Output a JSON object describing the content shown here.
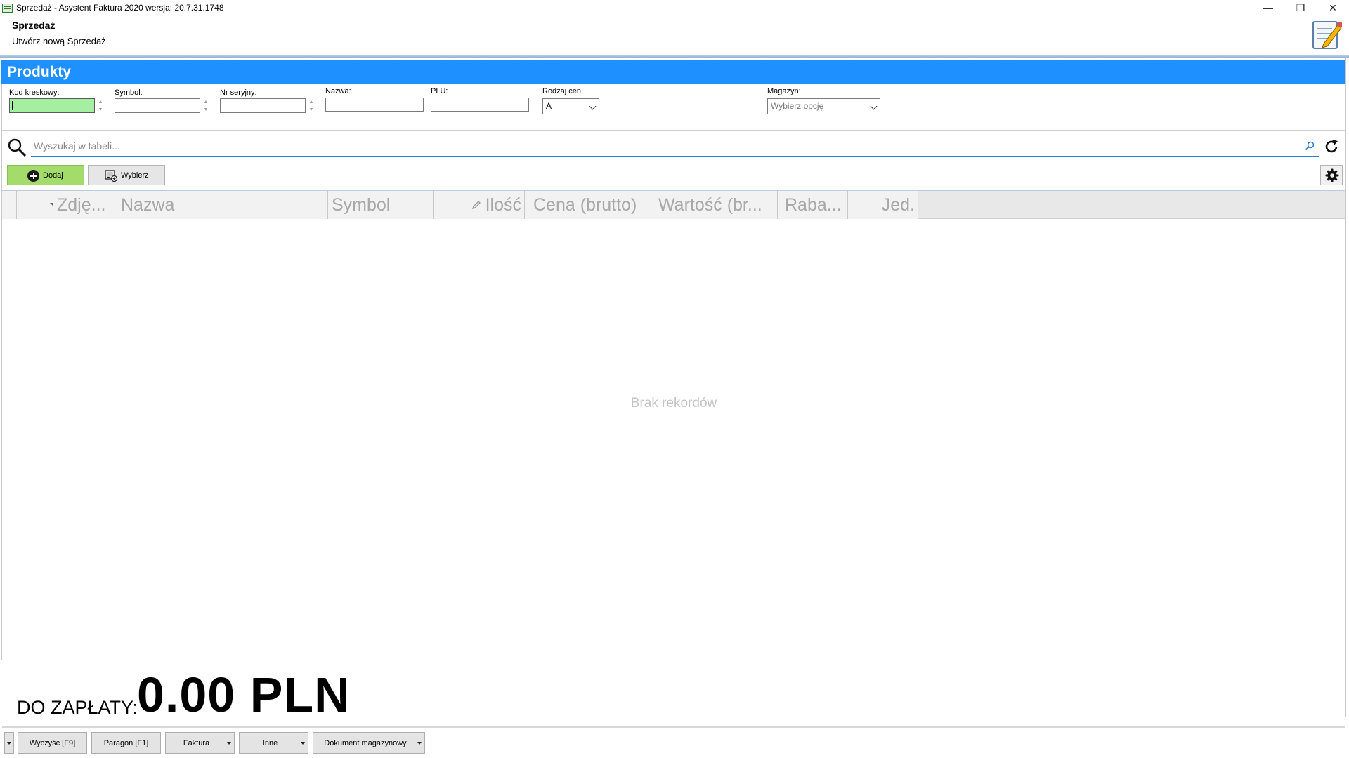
{
  "window": {
    "title": "Sprzedaż - Asystent Faktura 2020 wersja: 20.7.31.1748",
    "minimize_glyph": "—",
    "restore_glyph": "❐",
    "close_glyph": "✕"
  },
  "header": {
    "title": "Sprzedaż",
    "subtitle": "Utwórz nową Sprzedaż",
    "icon": "edit-document-icon"
  },
  "section": {
    "title": "Produkty",
    "accent_color": "#1e90ff"
  },
  "filters": {
    "kod_kreskowy": {
      "label": "Kod kreskowy:",
      "value": ""
    },
    "symbol": {
      "label": "Symbol:",
      "value": ""
    },
    "nr_seryjny": {
      "label": "Nr seryjny:",
      "value": ""
    },
    "nazwa": {
      "label": "Nazwa:",
      "value": ""
    },
    "plu": {
      "label": "PLU:",
      "value": ""
    },
    "rodzaj_cen": {
      "label": "Rodzaj cen:",
      "value": "A"
    },
    "magazyn": {
      "label": "Magazyn:",
      "placeholder": "Wybierz opcję"
    }
  },
  "search": {
    "placeholder": "Wyszukaj w tabeli..."
  },
  "toolbar": {
    "add_label": "Dodaj",
    "add_color": "#a4dc6c",
    "select_label": "Wybierz"
  },
  "table": {
    "columns": [
      {
        "label": "Zdję..."
      },
      {
        "label": "Nazwa"
      },
      {
        "label": "Symbol"
      },
      {
        "label": "Ilość"
      },
      {
        "label": "Cena (brutto)"
      },
      {
        "label": "Wartość (br..."
      },
      {
        "label": "Raba..."
      },
      {
        "label": "Jed."
      }
    ],
    "rows": [],
    "empty_message": "Brak rekordów"
  },
  "total": {
    "label": "DO ZAPŁATY:",
    "value": "0.00 PLN"
  },
  "bottom_bar": {
    "clear_label": "Wyczyść [F9]",
    "receipt_label": "Paragon [F1]",
    "invoice_label": "Faktura",
    "other_label": "Inne",
    "warehouse_doc_label": "Dokument magazynowy"
  }
}
